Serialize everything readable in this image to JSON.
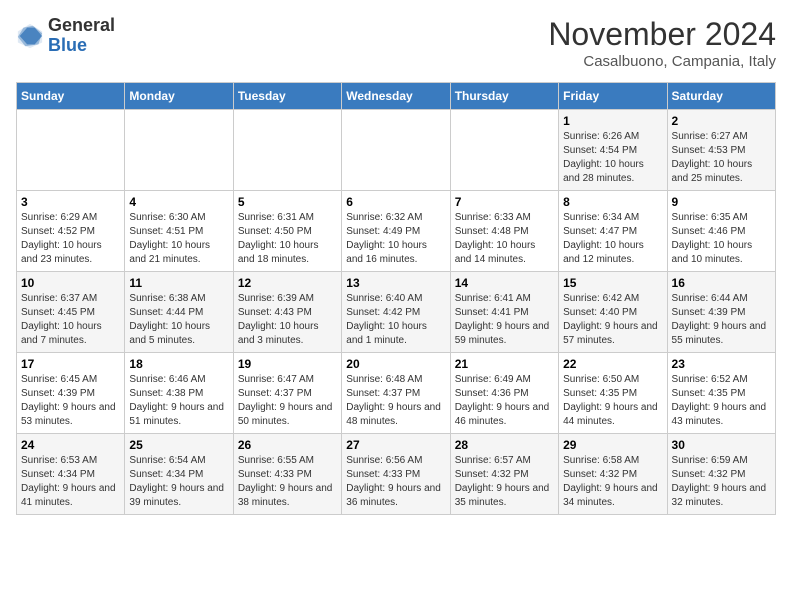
{
  "logo": {
    "general": "General",
    "blue": "Blue"
  },
  "header": {
    "month": "November 2024",
    "location": "Casalbuono, Campania, Italy"
  },
  "weekdays": [
    "Sunday",
    "Monday",
    "Tuesday",
    "Wednesday",
    "Thursday",
    "Friday",
    "Saturday"
  ],
  "weeks": [
    [
      {
        "day": "",
        "info": ""
      },
      {
        "day": "",
        "info": ""
      },
      {
        "day": "",
        "info": ""
      },
      {
        "day": "",
        "info": ""
      },
      {
        "day": "",
        "info": ""
      },
      {
        "day": "1",
        "info": "Sunrise: 6:26 AM\nSunset: 4:54 PM\nDaylight: 10 hours and 28 minutes."
      },
      {
        "day": "2",
        "info": "Sunrise: 6:27 AM\nSunset: 4:53 PM\nDaylight: 10 hours and 25 minutes."
      }
    ],
    [
      {
        "day": "3",
        "info": "Sunrise: 6:29 AM\nSunset: 4:52 PM\nDaylight: 10 hours and 23 minutes."
      },
      {
        "day": "4",
        "info": "Sunrise: 6:30 AM\nSunset: 4:51 PM\nDaylight: 10 hours and 21 minutes."
      },
      {
        "day": "5",
        "info": "Sunrise: 6:31 AM\nSunset: 4:50 PM\nDaylight: 10 hours and 18 minutes."
      },
      {
        "day": "6",
        "info": "Sunrise: 6:32 AM\nSunset: 4:49 PM\nDaylight: 10 hours and 16 minutes."
      },
      {
        "day": "7",
        "info": "Sunrise: 6:33 AM\nSunset: 4:48 PM\nDaylight: 10 hours and 14 minutes."
      },
      {
        "day": "8",
        "info": "Sunrise: 6:34 AM\nSunset: 4:47 PM\nDaylight: 10 hours and 12 minutes."
      },
      {
        "day": "9",
        "info": "Sunrise: 6:35 AM\nSunset: 4:46 PM\nDaylight: 10 hours and 10 minutes."
      }
    ],
    [
      {
        "day": "10",
        "info": "Sunrise: 6:37 AM\nSunset: 4:45 PM\nDaylight: 10 hours and 7 minutes."
      },
      {
        "day": "11",
        "info": "Sunrise: 6:38 AM\nSunset: 4:44 PM\nDaylight: 10 hours and 5 minutes."
      },
      {
        "day": "12",
        "info": "Sunrise: 6:39 AM\nSunset: 4:43 PM\nDaylight: 10 hours and 3 minutes."
      },
      {
        "day": "13",
        "info": "Sunrise: 6:40 AM\nSunset: 4:42 PM\nDaylight: 10 hours and 1 minute."
      },
      {
        "day": "14",
        "info": "Sunrise: 6:41 AM\nSunset: 4:41 PM\nDaylight: 9 hours and 59 minutes."
      },
      {
        "day": "15",
        "info": "Sunrise: 6:42 AM\nSunset: 4:40 PM\nDaylight: 9 hours and 57 minutes."
      },
      {
        "day": "16",
        "info": "Sunrise: 6:44 AM\nSunset: 4:39 PM\nDaylight: 9 hours and 55 minutes."
      }
    ],
    [
      {
        "day": "17",
        "info": "Sunrise: 6:45 AM\nSunset: 4:39 PM\nDaylight: 9 hours and 53 minutes."
      },
      {
        "day": "18",
        "info": "Sunrise: 6:46 AM\nSunset: 4:38 PM\nDaylight: 9 hours and 51 minutes."
      },
      {
        "day": "19",
        "info": "Sunrise: 6:47 AM\nSunset: 4:37 PM\nDaylight: 9 hours and 50 minutes."
      },
      {
        "day": "20",
        "info": "Sunrise: 6:48 AM\nSunset: 4:37 PM\nDaylight: 9 hours and 48 minutes."
      },
      {
        "day": "21",
        "info": "Sunrise: 6:49 AM\nSunset: 4:36 PM\nDaylight: 9 hours and 46 minutes."
      },
      {
        "day": "22",
        "info": "Sunrise: 6:50 AM\nSunset: 4:35 PM\nDaylight: 9 hours and 44 minutes."
      },
      {
        "day": "23",
        "info": "Sunrise: 6:52 AM\nSunset: 4:35 PM\nDaylight: 9 hours and 43 minutes."
      }
    ],
    [
      {
        "day": "24",
        "info": "Sunrise: 6:53 AM\nSunset: 4:34 PM\nDaylight: 9 hours and 41 minutes."
      },
      {
        "day": "25",
        "info": "Sunrise: 6:54 AM\nSunset: 4:34 PM\nDaylight: 9 hours and 39 minutes."
      },
      {
        "day": "26",
        "info": "Sunrise: 6:55 AM\nSunset: 4:33 PM\nDaylight: 9 hours and 38 minutes."
      },
      {
        "day": "27",
        "info": "Sunrise: 6:56 AM\nSunset: 4:33 PM\nDaylight: 9 hours and 36 minutes."
      },
      {
        "day": "28",
        "info": "Sunrise: 6:57 AM\nSunset: 4:32 PM\nDaylight: 9 hours and 35 minutes."
      },
      {
        "day": "29",
        "info": "Sunrise: 6:58 AM\nSunset: 4:32 PM\nDaylight: 9 hours and 34 minutes."
      },
      {
        "day": "30",
        "info": "Sunrise: 6:59 AM\nSunset: 4:32 PM\nDaylight: 9 hours and 32 minutes."
      }
    ]
  ]
}
